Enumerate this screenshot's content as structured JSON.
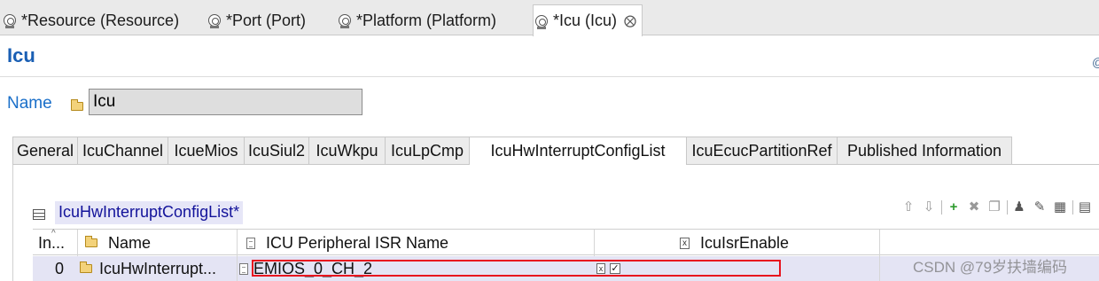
{
  "editor_tabs": [
    {
      "label": "*Resource (Resource)"
    },
    {
      "label": "*Port (Port)"
    },
    {
      "label": "*Platform (Platform)"
    },
    {
      "label": "*Icu (Icu)",
      "close": "⨂"
    }
  ],
  "page": {
    "title": "Icu",
    "help_icon": "@"
  },
  "name_field": {
    "label": "Name",
    "value": "Icu"
  },
  "config_tabs": [
    {
      "label": "General"
    },
    {
      "label": "IcuChannel"
    },
    {
      "label": "IcueMios"
    },
    {
      "label": "IcuSiul2"
    },
    {
      "label": "IcuWkpu"
    },
    {
      "label": "IcuLpCmp"
    },
    {
      "label": "IcuHwInterruptConfigList"
    },
    {
      "label": "IcuEcucPartitionRef"
    },
    {
      "label": "Published Information"
    }
  ],
  "section": {
    "title": "IcuHwInterruptConfigList*"
  },
  "toolbar_icons": [
    "arrow-up-icon",
    "arrow-down-icon",
    "add-icon",
    "delete-icon",
    "copy-icon",
    "user-icon",
    "edit-icon",
    "table-icon",
    "tray-icon"
  ],
  "table": {
    "columns": [
      {
        "label": "In..."
      },
      {
        "label": "Name"
      },
      {
        "label": "ICU Peripheral ISR Name"
      },
      {
        "label": "IcuIsrEnable"
      }
    ],
    "rows": [
      {
        "index": "0",
        "name": "IcuHwInterrupt...",
        "isr_name": "EMIOS_0_CH_2",
        "isr_enable": true
      }
    ]
  },
  "watermark": "CSDN @79岁扶墙编码",
  "colors": {
    "title_blue": "#1a5fb4",
    "section_highlight": "#e6e6f7",
    "selected_row": "#e4e4f4",
    "annotation_red": "#e8141e"
  }
}
